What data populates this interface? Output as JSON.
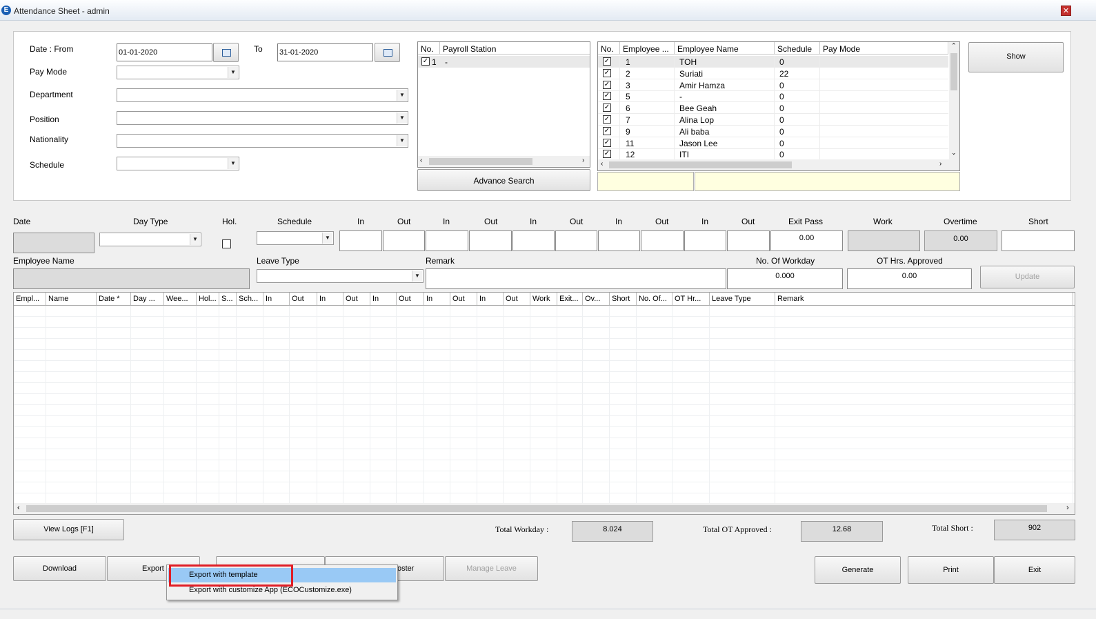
{
  "window": {
    "title": "Attendance Sheet - admin",
    "icon_letter": "E"
  },
  "filters": {
    "date_from_label": "Date : From",
    "date_from_value": "01-01-2020",
    "to_label": "To",
    "date_to_value": "31-01-2020",
    "paymode_label": "Pay Mode",
    "department_label": "Department",
    "position_label": "Position",
    "nationality_label": "Nationality",
    "schedule_label": "Schedule"
  },
  "payroll": {
    "col_no": "No.",
    "col_station": "Payroll Station",
    "rows": [
      {
        "no": "1",
        "station": "-",
        "checked": true
      }
    ],
    "advance_search_label": "Advance Search"
  },
  "employees": {
    "columns": [
      "No.",
      "Employee ...",
      "Employee Name",
      "Schedule",
      "Pay Mode"
    ],
    "rows": [
      {
        "no": "1",
        "name": "TOH",
        "schedule": "0",
        "paymode": ""
      },
      {
        "no": "2",
        "name": "Suriati",
        "schedule": "22",
        "paymode": ""
      },
      {
        "no": "3",
        "name": "Amir Hamza",
        "schedule": "0",
        "paymode": ""
      },
      {
        "no": "5",
        "name": "-",
        "schedule": "0",
        "paymode": ""
      },
      {
        "no": "6",
        "name": "Bee Geah",
        "schedule": "0",
        "paymode": ""
      },
      {
        "no": "7",
        "name": "Alina Lop",
        "schedule": "0",
        "paymode": ""
      },
      {
        "no": "9",
        "name": "Ali baba",
        "schedule": "0",
        "paymode": ""
      },
      {
        "no": "11",
        "name": "Jason Lee",
        "schedule": "0",
        "paymode": ""
      },
      {
        "no": "12",
        "name": "ITI",
        "schedule": "0",
        "paymode": ""
      }
    ],
    "show_label": "Show"
  },
  "entry": {
    "date_label": "Date",
    "daytype_label": "Day Type",
    "hol_label": "Hol.",
    "schedule_label": "Schedule",
    "io_labels": [
      "In",
      "Out",
      "In",
      "Out",
      "In",
      "Out",
      "In",
      "Out",
      "In",
      "Out"
    ],
    "exitpass_label": "Exit Pass",
    "exitpass_value": "0.00",
    "work_label": "Work",
    "overtime_label": "Overtime",
    "overtime_value": "0.00",
    "short_label": "Short",
    "empname_label": "Employee Name",
    "leavetype_label": "Leave Type",
    "remark_label": "Remark",
    "workday_label": "No. Of Workday",
    "workday_value": "0.000",
    "ot_label": "OT Hrs. Approved",
    "ot_value": "0.00",
    "update_label": "Update"
  },
  "main_grid": {
    "columns": [
      "Empl...",
      "Name",
      "Date *",
      "Day ...",
      "Wee...",
      "Hol...",
      "S...",
      "Sch...",
      "In",
      "Out",
      "In",
      "Out",
      "In",
      "Out",
      "In",
      "Out",
      "In",
      "Out",
      "Work",
      "Exit...",
      "Ov...",
      "Short",
      "No. Of...",
      "OT Hr...",
      "Leave Type",
      "Remark"
    ]
  },
  "totals": {
    "view_logs_label": "View Logs [F1]",
    "workday_label": "Total Workday :",
    "workday_value": "8.024",
    "ot_label": "Total OT Approved :",
    "ot_value": "12.68",
    "short_label": "Total Short :",
    "short_value": "902"
  },
  "buttons": {
    "download": "Download",
    "export": "Export",
    "roster": "oster",
    "manage_leave": "Manage Leave",
    "generate": "Generate",
    "print": "Print",
    "exit": "Exit"
  },
  "export_menu": {
    "items": [
      "Export with template",
      "Export with customize App (ECOCustomize.exe)"
    ],
    "selected": 0
  },
  "colors": {
    "highlight": "#99c9f5",
    "annotation": "#e01d25"
  }
}
